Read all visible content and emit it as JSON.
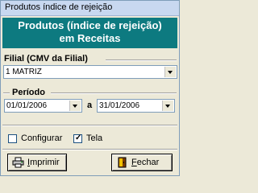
{
  "window": {
    "title": "Produtos índice de rejeição"
  },
  "banner": {
    "line1": "Produtos (índice de rejeição)",
    "line2": "em Receitas"
  },
  "filial": {
    "label": "Filial (CMV da Filial)",
    "value": "1 MATRIZ"
  },
  "periodo": {
    "label": "Período",
    "start": "01/01/2006",
    "separator": "a",
    "end": "31/01/2006"
  },
  "options": {
    "configurar": {
      "label": "Configurar",
      "checked": false
    },
    "tela": {
      "label": "Tela",
      "checked": true,
      "mark": "✓"
    }
  },
  "buttons": {
    "imprimir": {
      "label": "Imprimir",
      "icon": "printer-icon"
    },
    "fechar": {
      "label": "Fechar",
      "icon": "exit-door-icon"
    }
  }
}
